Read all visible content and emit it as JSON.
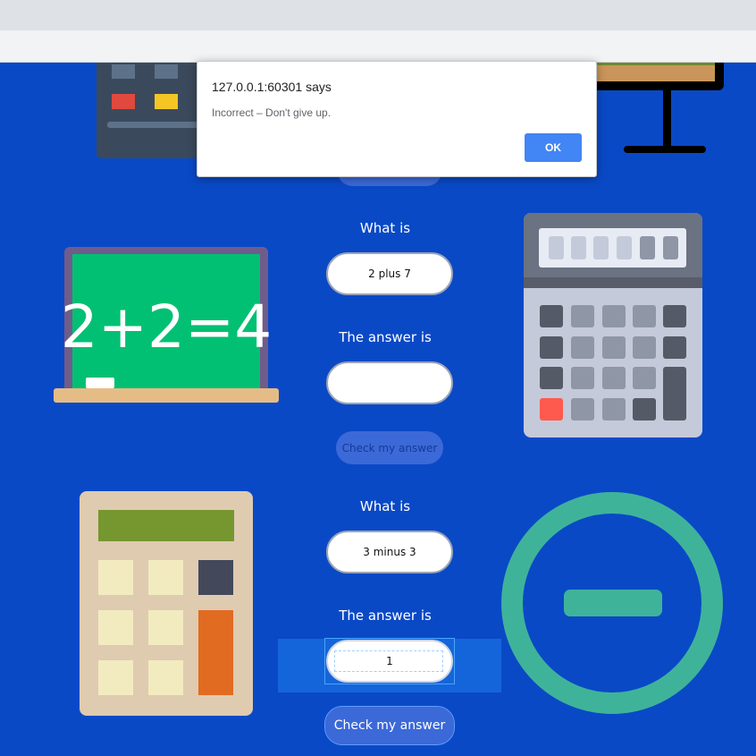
{
  "dialog": {
    "title": "127.0.0.1:60301 says",
    "message": "Incorrect – Don't give up.",
    "ok_label": "OK"
  },
  "quiz": [
    {
      "question_label": "What is",
      "question_value": "2 plus 7",
      "answer_label": "The answer is",
      "answer_value": "",
      "check_label": "Check my answer"
    },
    {
      "question_label": "What is",
      "question_value": "3 minus 3",
      "answer_label": "The answer is",
      "answer_value": "1",
      "check_label": "Check my answer"
    }
  ],
  "chalkboard": {
    "equation": "2+2=4"
  },
  "colors": {
    "page_background": "#0a49c6",
    "button": "#3c69d8",
    "dialog_ok": "#4285f4",
    "chalkboard_green": "#02c073",
    "minus_circle": "#3fb39a"
  },
  "icons": [
    "calculator-icon",
    "monitor-icon",
    "chalkboard-icon",
    "calculator-icon",
    "calculator-icon",
    "minus-circle-icon"
  ]
}
